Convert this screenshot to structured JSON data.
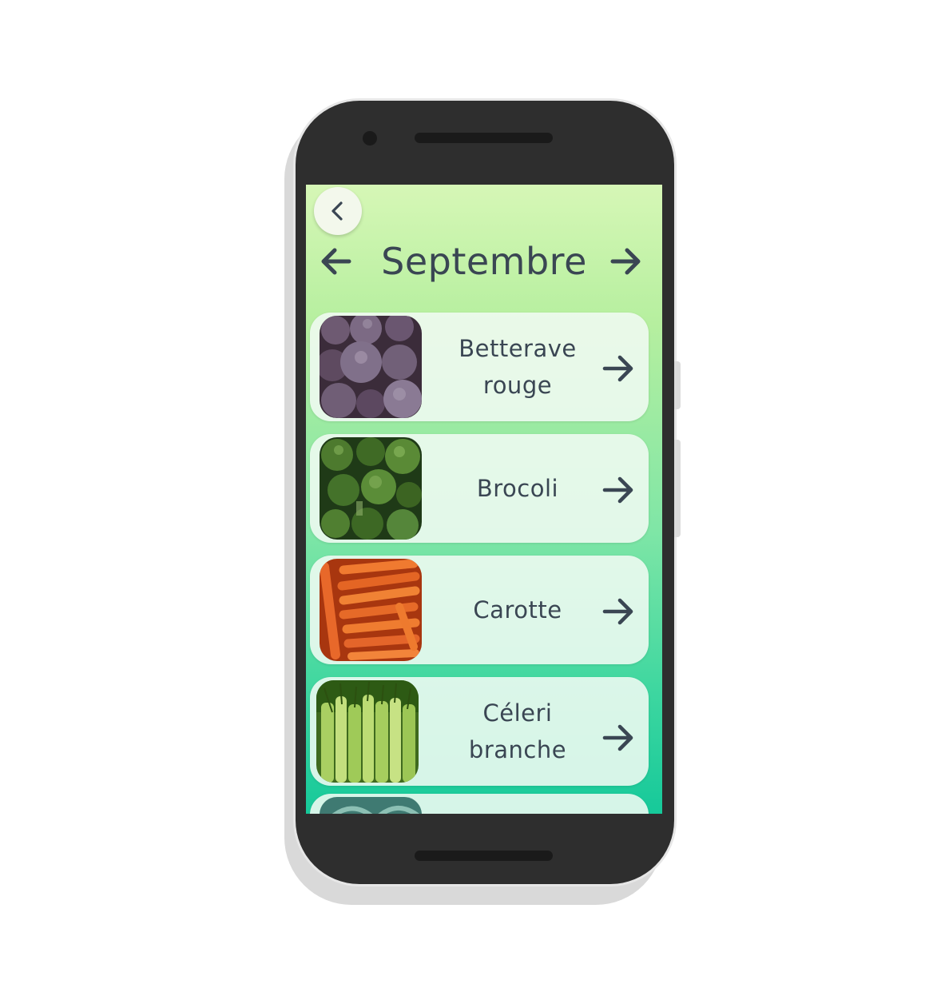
{
  "screen": {
    "back_icon": "chevron-left-icon",
    "prev_icon": "arrow-left-icon",
    "next_icon": "arrow-right-icon",
    "month": "Septembre"
  },
  "vegetables": [
    {
      "name": "Betterave\nrouge",
      "image": "beetroot-photo",
      "icon": "arrow-right-icon"
    },
    {
      "name": "Brocoli",
      "image": "broccoli-photo",
      "icon": "arrow-right-icon"
    },
    {
      "name": "Carotte",
      "image": "carrot-photo",
      "icon": "arrow-right-icon"
    },
    {
      "name": "Céleri\nbranche",
      "image": "celery-photo",
      "icon": "arrow-right-icon"
    },
    {
      "name": "",
      "image": "leek-photo",
      "icon": "arrow-right-icon"
    }
  ],
  "colors": {
    "text": "#3a4653",
    "gradient_top": "#d6f7b6",
    "gradient_bottom": "#16c99a",
    "card_bg": "#f0faf2",
    "phone_body": "#2e2e2e"
  }
}
